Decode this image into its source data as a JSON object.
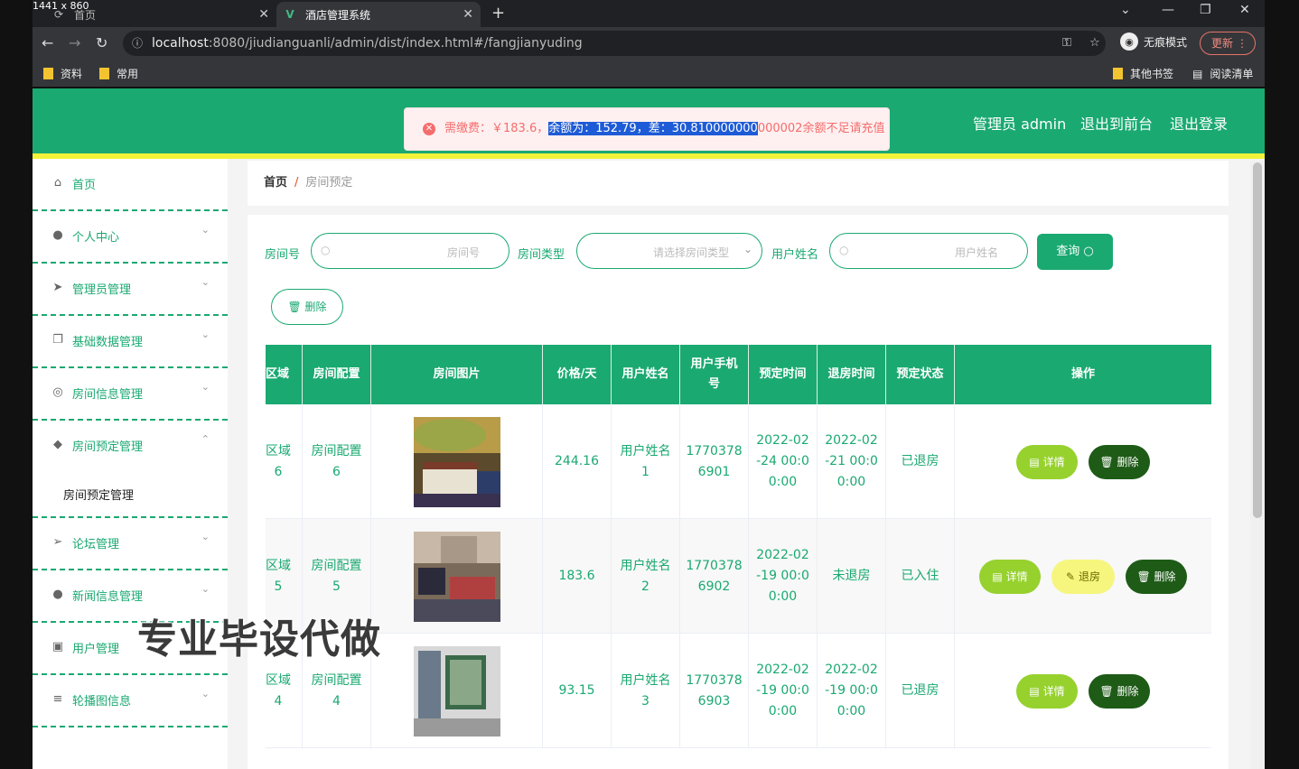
{
  "screen_dims": "1441 x 860",
  "browser": {
    "tabs": [
      {
        "label": "首页"
      },
      {
        "label": "酒店管理系统"
      }
    ],
    "url_host": "localhost",
    "url_rest": ":8080/jiudianguanli/admin/dist/index.html#/fangjianyuding",
    "incognito_label": "无痕模式",
    "update_label": "更新",
    "bookmarks": [
      "资料",
      "常用"
    ],
    "bookmarks_right": [
      "其他书签",
      "阅读清单"
    ]
  },
  "header": {
    "admin_label": "管理员 admin",
    "front_label": "退出到前台",
    "logout_label": "退出登录"
  },
  "toast": {
    "pre": "需缴费：￥183.6，",
    "selected": "余额为：152.79，差：30.810000000",
    "post": "000002余额不足请充值"
  },
  "sidebar": {
    "items": [
      {
        "label": "首页",
        "icon": "home-icon"
      },
      {
        "label": "个人中心",
        "icon": "user-icon"
      },
      {
        "label": "管理员管理",
        "icon": "send-icon"
      },
      {
        "label": "基础数据管理",
        "icon": "copy-icon"
      },
      {
        "label": "房间信息管理",
        "icon": "compass-icon"
      },
      {
        "label": "房间预定管理",
        "icon": "pin-icon"
      },
      {
        "label": "房间预定管理"
      },
      {
        "label": "论坛管理",
        "icon": "navigation-icon"
      },
      {
        "label": "新闻信息管理",
        "icon": "person-icon"
      },
      {
        "label": "用户管理",
        "icon": "chart-icon"
      },
      {
        "label": "轮播图信息",
        "icon": "menu-icon"
      }
    ]
  },
  "breadcrumb": {
    "home": "首页",
    "sep": "/",
    "current": "房间预定"
  },
  "filters": {
    "room_no_label": "房间号",
    "room_no_placeholder": "房间号",
    "room_type_label": "房间类型",
    "room_type_placeholder": "请选择房间类型",
    "user_name_label": "用户姓名",
    "user_name_placeholder": "用户姓名",
    "query_label": "查询",
    "delete_label": "删除"
  },
  "table": {
    "headers": [
      "区域",
      "房间配置",
      "房间图片",
      "价格/天",
      "用户姓名",
      "用户手机号",
      "预定时间",
      "退房时间",
      "预定状态",
      "操作"
    ],
    "rows": [
      {
        "area": "区域\n6",
        "config": "房间配置\n6",
        "price": "244.16",
        "user": "用户姓名\n1",
        "phone": "1770378\n6901",
        "book": "2022-02\n-24 00:0\n0:00",
        "checkout": "2022-02\n-21 00:0\n0:00",
        "status": "已退房",
        "actions": [
          "详情",
          "删除"
        ]
      },
      {
        "area": "区域\n5",
        "config": "房间配置\n5",
        "price": "183.6",
        "user": "用户姓名\n2",
        "phone": "1770378\n6902",
        "book": "2022-02\n-19 00:0\n0:00",
        "checkout": "未退房",
        "status": "已入住",
        "actions": [
          "详情",
          "退房",
          "删除"
        ]
      },
      {
        "area": "区域\n4",
        "config": "房间配置\n4",
        "price": "93.15",
        "user": "用户姓名\n3",
        "phone": "1770378\n6903",
        "book": "2022-02\n-19 00:0\n0:00",
        "checkout": "2022-02\n-19 00:0\n0:00",
        "status": "已退房",
        "actions": [
          "详情",
          "删除"
        ]
      }
    ]
  },
  "watermark": "专业毕设代做",
  "colors": {
    "primary": "#1aa971",
    "accent_line": "#f2f23a",
    "detail_btn": "#96d12e",
    "delete_btn": "#1e5b17",
    "checkout_btn": "#f6f67e",
    "error": "#f56c6c"
  }
}
